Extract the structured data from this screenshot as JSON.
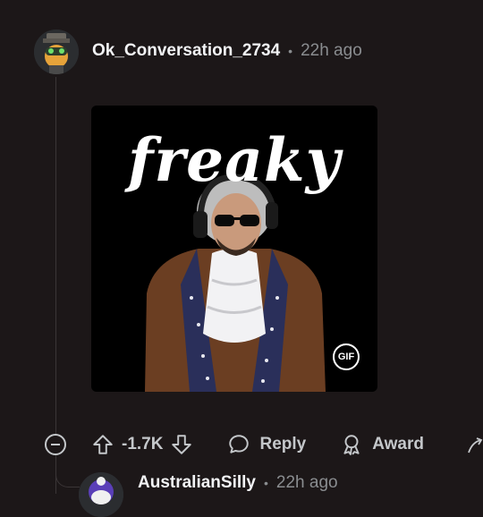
{
  "comment": {
    "username": "Ok_Conversation_2734",
    "time": "22h ago",
    "separator": "•",
    "gif": {
      "caption": "freaky",
      "badge": "GIF"
    },
    "actions": {
      "vote_count": "-1.7K",
      "reply_label": "Reply",
      "award_label": "Award"
    }
  },
  "reply": {
    "username": "AustralianSilly",
    "time": "22h ago",
    "separator": "•"
  },
  "icons": [
    "collapse-icon",
    "upvote-icon",
    "downvote-icon",
    "reply-icon",
    "award-icon",
    "share-icon"
  ],
  "colors": {
    "background": "#1c1718",
    "text": "#d7dadc",
    "muted": "#8a8d90"
  }
}
